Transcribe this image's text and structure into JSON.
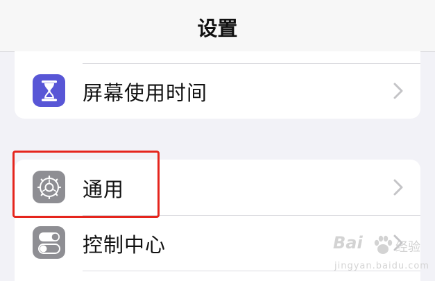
{
  "navbar": {
    "title": "设置"
  },
  "settings": {
    "items": [
      {
        "label": "屏幕使用时间",
        "icon": "hourglass-icon",
        "icon_color": "#5856d6"
      },
      {
        "label": "通用",
        "icon": "gear-icon",
        "icon_color": "#8e8e93"
      },
      {
        "label": "控制中心",
        "icon": "toggles-icon",
        "icon_color": "#8e8e93"
      }
    ]
  },
  "annotation": {
    "highlight_color": "#e5251d"
  },
  "watermark": {
    "brand": "Bai",
    "sub": "经验",
    "url": "jingyan.baidu.com"
  }
}
